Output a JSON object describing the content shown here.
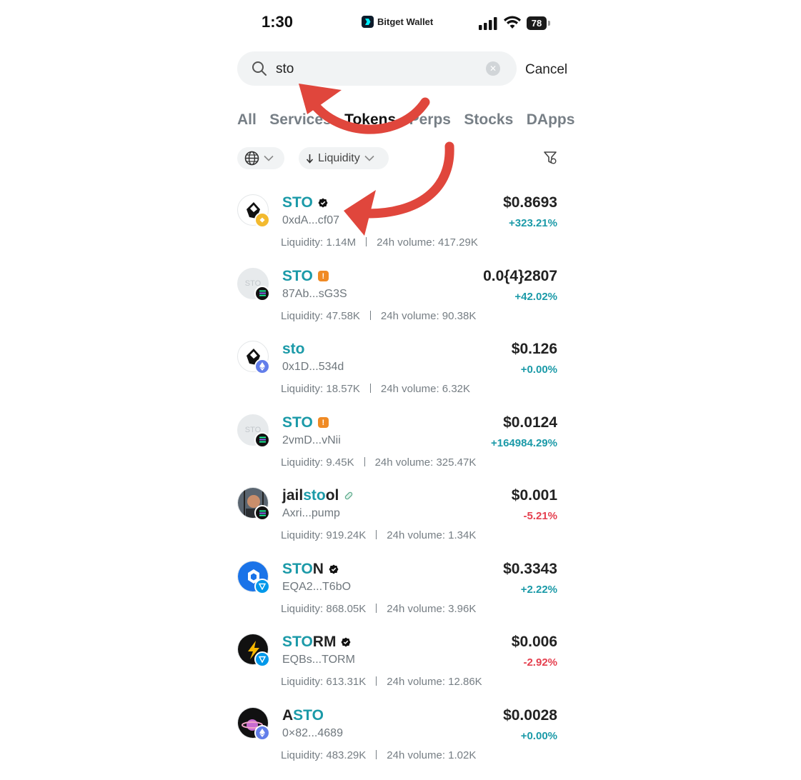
{
  "status_bar": {
    "time": "1:30",
    "brand": "Bitget Wallet",
    "battery": "78"
  },
  "search": {
    "value": "sto",
    "placeholder": "",
    "cancel_label": "Cancel"
  },
  "tabs": [
    {
      "label": "All"
    },
    {
      "label": "Services"
    },
    {
      "label": "Tokens"
    },
    {
      "label": "Perps"
    },
    {
      "label": "Stocks"
    },
    {
      "label": "DApps"
    }
  ],
  "filters": {
    "sort_label": "Liquidity"
  },
  "tokens": [
    {
      "pre": "",
      "match": "STO",
      "post": "",
      "badge": "verified",
      "address": "0xdA...cf07",
      "liquidity": "Liquidity: 1.14M",
      "volume": "24h volume: 417.29K",
      "price": "$0.8693",
      "change": "+323.21%",
      "direction": "up",
      "chain": "bnb",
      "avatar": "crystal"
    },
    {
      "pre": "",
      "match": "STO",
      "post": "",
      "badge": "warning",
      "address": "87Ab...sG3S",
      "liquidity": "Liquidity: 47.58K",
      "volume": "24h volume: 90.38K",
      "price": "0.0{4}2807",
      "change": "+42.02%",
      "direction": "up",
      "chain": "solana",
      "avatar": "placeholder",
      "avatar_text": "STO"
    },
    {
      "pre": "",
      "match": "sto",
      "post": "",
      "badge": "none",
      "address": "0x1D...534d",
      "liquidity": "Liquidity: 18.57K",
      "volume": "24h volume: 6.32K",
      "price": "$0.126",
      "change": "+0.00%",
      "direction": "up",
      "chain": "ethereum",
      "avatar": "crystal"
    },
    {
      "pre": "",
      "match": "STO",
      "post": "",
      "badge": "warning",
      "address": "2vmD...vNii",
      "liquidity": "Liquidity: 9.45K",
      "volume": "24h volume: 325.47K",
      "price": "$0.0124",
      "change": "+164984.29%",
      "direction": "up",
      "chain": "solana",
      "avatar": "placeholder",
      "avatar_text": "STO"
    },
    {
      "pre": "jail",
      "match": "sto",
      "post": "ol",
      "badge": "pill",
      "address": "Axri...pump",
      "liquidity": "Liquidity: 919.24K",
      "volume": "24h volume: 1.34K",
      "price": "$0.001",
      "change": "-5.21%",
      "direction": "down",
      "chain": "solana",
      "avatar": "person"
    },
    {
      "pre": "",
      "match": "STO",
      "post": "N",
      "badge": "verified",
      "address": "EQA2...T6bO",
      "liquidity": "Liquidity: 868.05K",
      "volume": "24h volume: 3.96K",
      "price": "$0.3343",
      "change": "+2.22%",
      "direction": "up",
      "chain": "ton",
      "avatar": "ston"
    },
    {
      "pre": "",
      "match": "STO",
      "post": "RM",
      "badge": "verified",
      "address": "EQBs...TORM",
      "liquidity": "Liquidity: 613.31K",
      "volume": "24h volume: 12.86K",
      "price": "$0.006",
      "change": "-2.92%",
      "direction": "down",
      "chain": "ton",
      "avatar": "storm"
    },
    {
      "pre": "A",
      "match": "STO",
      "post": "",
      "badge": "none",
      "address": "0×82...4689",
      "liquidity": "Liquidity: 483.29K",
      "volume": "24h volume: 1.02K",
      "price": "$0.0028",
      "change": "+0.00%",
      "direction": "up",
      "chain": "ethereum",
      "avatar": "planet"
    }
  ],
  "colors": {
    "accent": "#1b9aa8",
    "negative": "#e5404f",
    "warning": "#f08a24",
    "annotation_arrow": "#e0463c"
  }
}
